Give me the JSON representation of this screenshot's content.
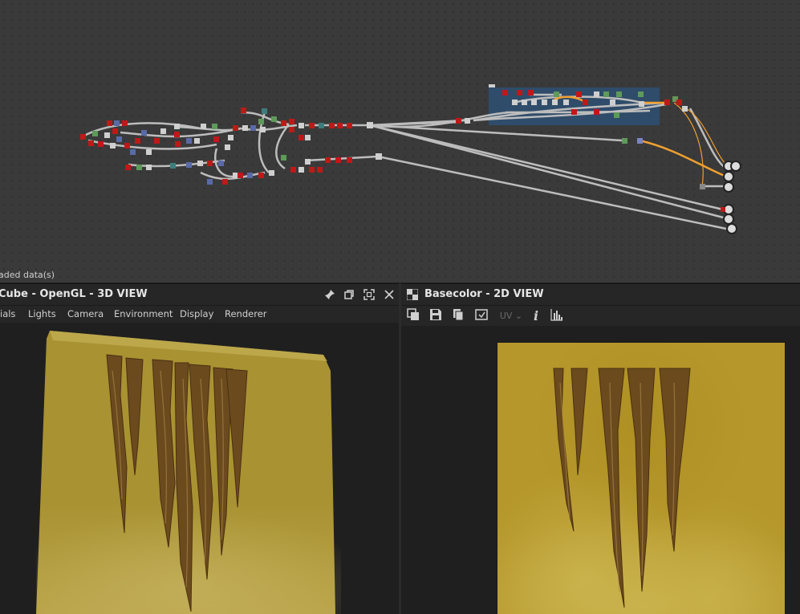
{
  "graph": {
    "status_text": "aded data(s)"
  },
  "view3d": {
    "title": "Cube - OpenGL - 3D VIEW",
    "menu": [
      "ials",
      "Lights",
      "Camera",
      "Environment",
      "Display",
      "Renderer"
    ],
    "icons": [
      "pin-icon",
      "restore-icon",
      "maximize-icon",
      "close-icon"
    ]
  },
  "view2d": {
    "title": "Basecolor - 2D VIEW",
    "uv_label": "UV",
    "tools": [
      "copy-icon",
      "save-icon",
      "duplicate-icon",
      "refresh-icon",
      "uv-dropdown",
      "info-icon",
      "histogram-icon"
    ]
  },
  "colors": {
    "graph_bg": "#3a3a3a",
    "frame_blue": "#2f4f70",
    "wire": "#bdbdbd",
    "wire_orange": "#f0a030",
    "node_red": "#c01818",
    "node_blue": "#5a6aa8",
    "node_green": "#5e9a5a",
    "node_teal": "#3d7d7d",
    "texture": "#b5972b"
  }
}
